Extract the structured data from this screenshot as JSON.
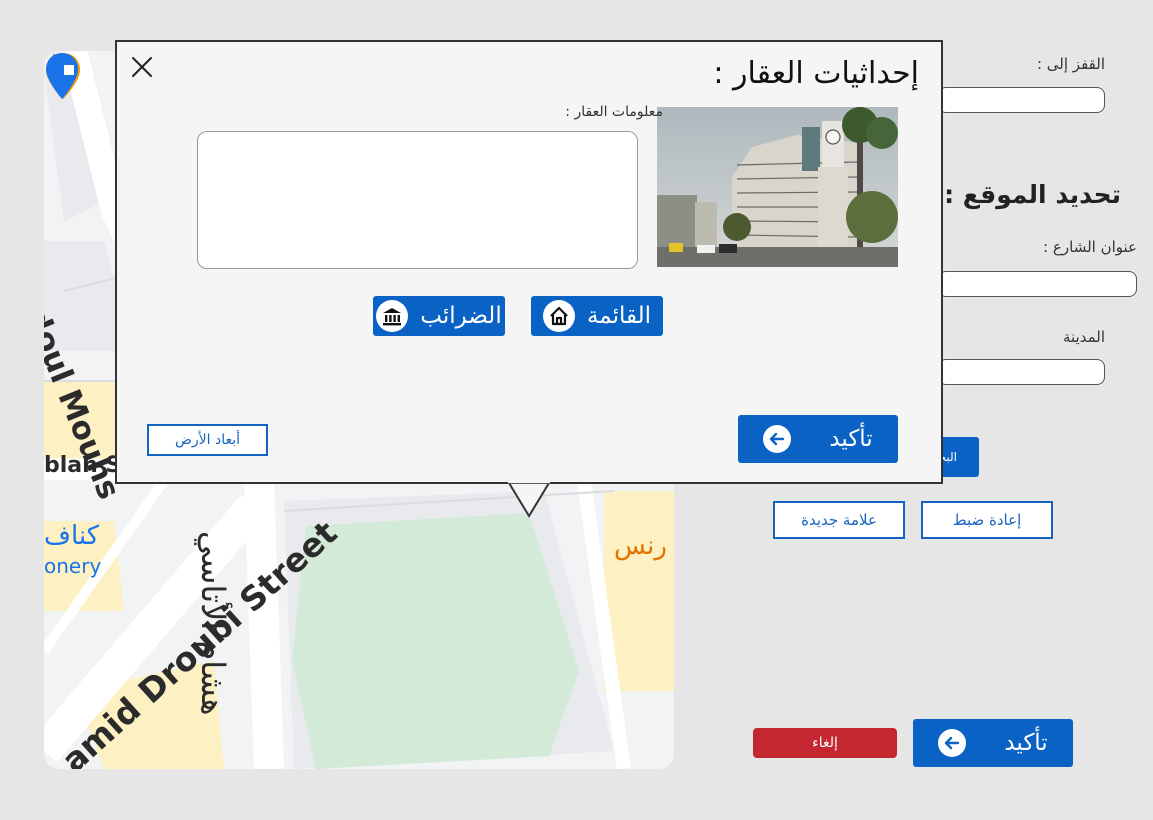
{
  "form": {
    "jump_label": "القفز إلى :",
    "jump_value": "",
    "section_title": "تحديد الموقع :",
    "street_label": "عنوان الشارع :",
    "street_value": "",
    "city_label": "المدينة",
    "city_value": "",
    "search_button_label": "البحث",
    "reset_button_label": "إعادة ضبط",
    "new_marker_button_label": "علامة جديدة",
    "cancel_button_label": "إلغاء",
    "confirm_button_label": "تأكيد"
  },
  "map": {
    "labels": {
      "abdoul": "Abdoul Mouhs",
      "ablan": "blan S",
      "kanafa": "كناف",
      "onery": "onery",
      "hamid_droubi": "amid Droubi Street",
      "hisham": "هشام الأتاسي",
      "rns": "رنس"
    },
    "colors": {
      "park": "#d4ead9",
      "road": "#ffffff",
      "block": "#e8eaed",
      "highlight": "#fdf1c4"
    }
  },
  "modal": {
    "title": "إحداثيات العقار :",
    "info_label": "معلومات العقار :",
    "info_value": "",
    "list_button_label": "القائمة",
    "taxes_button_label": "الضرائب",
    "dims_button_label": "أبعاد الأرض",
    "confirm_button_label": "تأكيد"
  },
  "colors": {
    "accent": "#0a63c4",
    "danger": "#c4272f",
    "background": "#e6e6e6"
  }
}
